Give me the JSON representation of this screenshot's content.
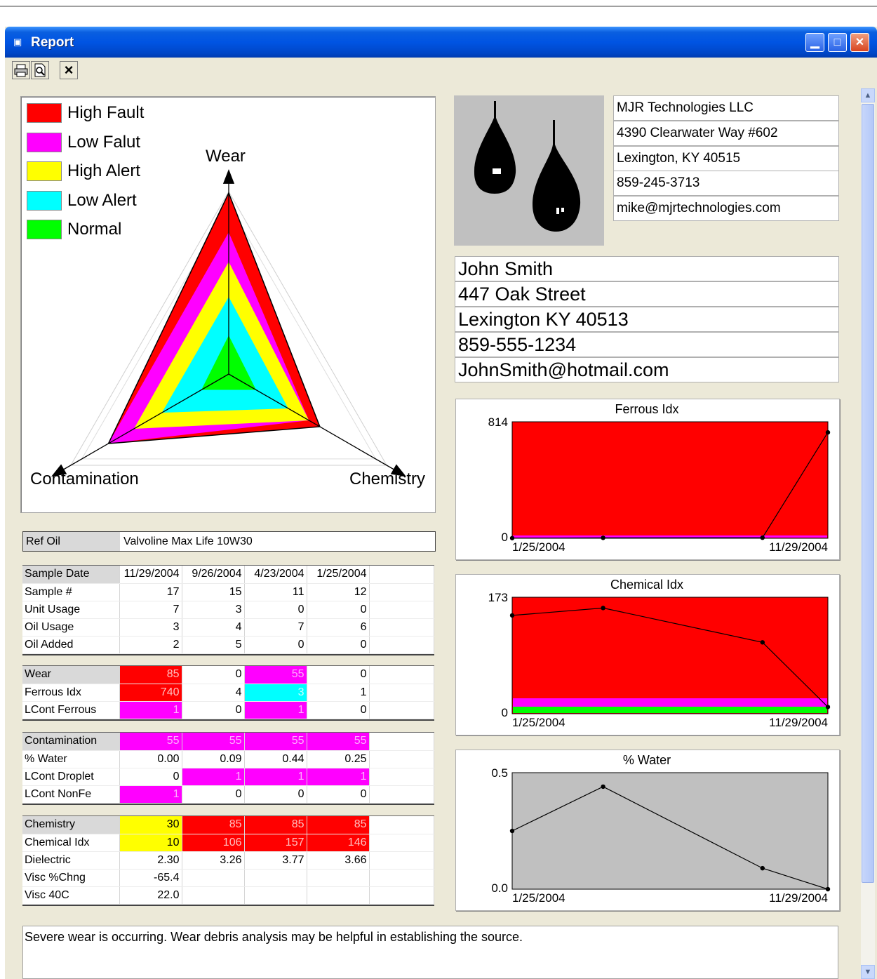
{
  "window": {
    "title": "Report",
    "min_label": "_",
    "max_label": "□",
    "close_label": "✕"
  },
  "toolbar": {
    "print_icon": "print-icon",
    "preview_icon": "print-preview-icon",
    "close_label": "×"
  },
  "legend": [
    {
      "label": "High Fault",
      "color": "#ff0000"
    },
    {
      "label": "Low Falut",
      "color": "#ff00ff"
    },
    {
      "label": "High Alert",
      "color": "#ffff00"
    },
    {
      "label": "Low Alert",
      "color": "#00ffff"
    },
    {
      "label": "Normal",
      "color": "#00ff00"
    }
  ],
  "radar": {
    "axis_wear": "Wear",
    "axis_contamination": "Contamination",
    "axis_chemistry": "Chemistry"
  },
  "company": {
    "name": "MJR Technologies LLC",
    "address": "4390 Clearwater Way #602",
    "city": "Lexington, KY 40515",
    "phone": "859-245-3713",
    "email": "mike@mjrtechnologies.com"
  },
  "customer": {
    "name": "John Smith",
    "address": "447 Oak Street",
    "city": "Lexington KY 40513",
    "phone": "859-555-1234",
    "email": "JohnSmith@hotmail.com"
  },
  "ref_oil": {
    "label": "Ref Oil",
    "value": "Valvoline Max Life 10W30"
  },
  "sample_table": {
    "header": [
      "Sample Date",
      "11/29/2004",
      "9/26/2004",
      "4/23/2004",
      "1/25/2004"
    ],
    "rows": [
      [
        "Sample #",
        "17",
        "15",
        "11",
        "12"
      ],
      [
        "Unit Usage",
        "7",
        "3",
        "0",
        "0"
      ],
      [
        "Oil Usage",
        "3",
        "4",
        "7",
        "6"
      ],
      [
        "Oil Added",
        "2",
        "5",
        "0",
        "0"
      ]
    ]
  },
  "wear_table": {
    "header": [
      "Wear",
      "85",
      "0",
      "55",
      "0"
    ],
    "rows": [
      [
        "Ferrous Idx",
        "740",
        "4",
        "3",
        "1"
      ],
      [
        "LCont Ferrous",
        "1",
        "0",
        "1",
        "0"
      ]
    ]
  },
  "contamination_table": {
    "header": [
      "Contamination",
      "55",
      "55",
      "55",
      "55"
    ],
    "rows": [
      [
        "% Water",
        "0.00",
        "0.09",
        "0.44",
        "0.25"
      ],
      [
        "LCont Droplet",
        "0",
        "1",
        "1",
        "1"
      ],
      [
        "LCont NonFe",
        "1",
        "0",
        "0",
        "0"
      ]
    ]
  },
  "chemistry_table": {
    "header": [
      "Chemistry",
      "30",
      "85",
      "85",
      "85"
    ],
    "rows": [
      [
        "Chemical Idx",
        "10",
        "106",
        "157",
        "146"
      ],
      [
        "Dielectric",
        "2.30",
        "3.26",
        "3.77",
        "3.66"
      ],
      [
        "Visc %Chng",
        "-65.4",
        "",
        "",
        ""
      ],
      [
        "Visc 40C",
        "22.0",
        "",
        "",
        ""
      ]
    ]
  },
  "cell_colors": {
    "red": "#ff0000",
    "magenta": "#ff00ff",
    "yellow": "#ffff00",
    "cyan": "#00ffff"
  },
  "chart_data": [
    {
      "type": "line",
      "title": "Ferrous Idx",
      "x": [
        "1/25/2004",
        "4/23/2004",
        "9/26/2004",
        "11/29/2004"
      ],
      "x_tick_labels": [
        "1/25/2004",
        "11/29/2004"
      ],
      "values": [
        1,
        3,
        4,
        740
      ],
      "ylim": [
        0,
        814
      ],
      "y_tick_labels": [
        "0",
        "814"
      ],
      "background": "#ff0000"
    },
    {
      "type": "line",
      "title": "Chemical Idx",
      "x": [
        "1/25/2004",
        "4/23/2004",
        "9/26/2004",
        "11/29/2004"
      ],
      "x_tick_labels": [
        "1/25/2004",
        "11/29/2004"
      ],
      "values": [
        146,
        157,
        106,
        10
      ],
      "ylim": [
        0,
        173
      ],
      "y_tick_labels": [
        "0",
        "173"
      ],
      "background": "#ff0000"
    },
    {
      "type": "line",
      "title": "% Water",
      "x": [
        "1/25/2004",
        "4/23/2004",
        "9/26/2004",
        "11/29/2004"
      ],
      "x_tick_labels": [
        "1/25/2004",
        "11/29/2004"
      ],
      "values": [
        0.25,
        0.44,
        0.09,
        0.0
      ],
      "ylim": [
        0,
        0.5
      ],
      "y_tick_labels": [
        "0.0",
        "0.5"
      ],
      "background": "#c0c0c0"
    }
  ],
  "comment": "Severe wear is occurring.  Wear debris analysis may be helpful in establishing the source."
}
